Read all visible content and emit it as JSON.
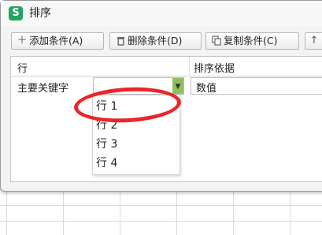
{
  "window": {
    "title": "排序",
    "app_icon_glyph": "S",
    "accent_color": "#21a366"
  },
  "toolbar": {
    "add_label": "添加条件(A)",
    "delete_label": "删除条件(D)",
    "copy_label": "复制条件(C)",
    "add_icon": "plus-icon",
    "delete_icon": "trash-icon",
    "copy_icon": "copy-icon"
  },
  "table": {
    "col_row": "行",
    "col_sort_basis": "排序依据"
  },
  "condition": {
    "label": "主要关键字",
    "keyword_value": "",
    "sort_basis_value": "数值"
  },
  "dropdown_options": [
    "行 1",
    "行 2",
    "行 3",
    "行 4"
  ],
  "annotation": {
    "color": "#e8262b"
  }
}
